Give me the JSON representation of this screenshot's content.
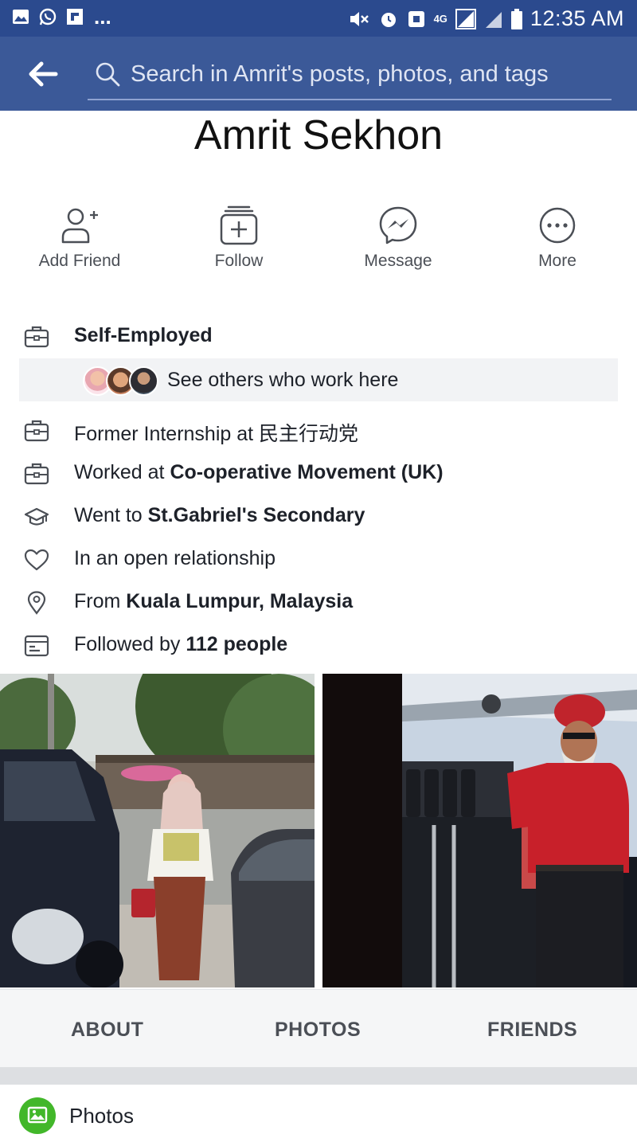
{
  "status_bar": {
    "time": "12:35 AM",
    "network": "4G",
    "overflow": "..."
  },
  "search": {
    "placeholder": "Search in Amrit's posts, photos, and tags"
  },
  "profile": {
    "name": "Amrit Sekhon"
  },
  "actions": [
    {
      "label": "Add Friend",
      "icon": "add-friend-icon"
    },
    {
      "label": "Follow",
      "icon": "follow-icon"
    },
    {
      "label": "Message",
      "icon": "messenger-icon"
    },
    {
      "label": "More",
      "icon": "more-icon"
    }
  ],
  "info": {
    "work_current": "Self-Employed",
    "work_others": "See others who work here",
    "internship_prefix": "Former Internship at ",
    "internship_org": "民主行动党",
    "worked_prefix": "Worked at ",
    "worked_org": "Co-operative Movement (UK)",
    "school_prefix": "Went to ",
    "school": "St.Gabriel's Secondary",
    "relationship": "In an open relationship",
    "from_prefix": "From ",
    "from": "Kuala Lumpur, Malaysia",
    "followers_prefix": "Followed by ",
    "followers": "112 people"
  },
  "tabs": [
    "ABOUT",
    "PHOTOS",
    "FRIENDS"
  ],
  "section": {
    "title": "Photos"
  },
  "colors": {
    "header": "#3b5998",
    "status_bar": "#2b4a8e",
    "tab_bar": "#f5f6f7",
    "photos_icon": "#42b72a"
  }
}
